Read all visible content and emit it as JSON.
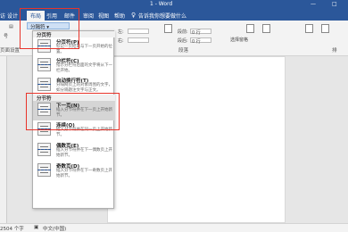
{
  "window": {
    "title": "1 - Word",
    "minimize": "—",
    "maximize": "□"
  },
  "tabs": [
    "访",
    "设计",
    "布局",
    "引用",
    "邮件",
    "审阅",
    "视图",
    "帮助"
  ],
  "tell_me": "告诉我你想要做什么",
  "ribbon": {
    "breaks_button": "分隔符",
    "indent_left_label": "左:",
    "indent_right_label": "右:",
    "spacing_before_label": "段前:",
    "spacing_after_label": "段后:",
    "zero_value": "0 行",
    "select_pane": "选择窗格",
    "paragraph_group": "段落",
    "page_setup_group": "页面设置",
    "number_label": "号",
    "arrange_label": "排"
  },
  "menu": {
    "page_breaks_header": "分页符",
    "section_breaks_header": "分节符",
    "items": [
      {
        "title": "分页符(P)",
        "desc": "标记一页结束与下一页开始的位置。"
      },
      {
        "title": "分栏符(C)",
        "desc": "指示分栏符后面的文字将从下一栏开始。"
      },
      {
        "title": "自动换行符(T)",
        "desc": "分隔网页上的对象周围的文字，如分隔题注文字与正文。"
      },
      {
        "title": "下一页(N)",
        "desc": "插入分节符并在下一页上开始新节。"
      },
      {
        "title": "连续(O)",
        "desc": "插入分节符并在同一页上开始新节。"
      },
      {
        "title": "偶数页(E)",
        "desc": "插入分节符并在下一偶数页上开始新节。"
      },
      {
        "title": "奇数页(D)",
        "desc": "插入分节符并在下一奇数页上开始新节。"
      }
    ]
  },
  "status": {
    "words": "2504 个字",
    "language": "中文(中国)"
  },
  "colors": {
    "accent": "#2b579a",
    "highlight": "#e8342a"
  }
}
